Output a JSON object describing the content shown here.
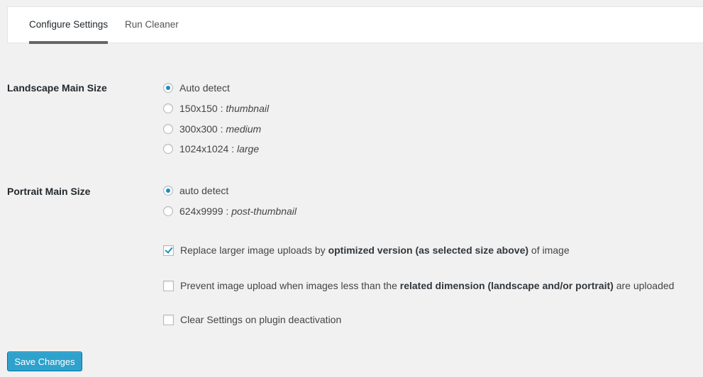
{
  "tabs": [
    {
      "label": "Configure Settings",
      "active": true
    },
    {
      "label": "Run Cleaner",
      "active": false
    }
  ],
  "landscape": {
    "label": "Landscape Main Size",
    "options": [
      {
        "size": "Auto detect",
        "name": "",
        "checked": true
      },
      {
        "size": "150x150 : ",
        "name": "thumbnail",
        "checked": false
      },
      {
        "size": "300x300 : ",
        "name": "medium",
        "checked": false
      },
      {
        "size": "1024x1024 : ",
        "name": "large",
        "checked": false
      }
    ]
  },
  "portrait": {
    "label": "Portrait Main Size",
    "options": [
      {
        "size": "auto detect",
        "name": "",
        "checked": true
      },
      {
        "size": "624x9999 : ",
        "name": "post-thumbnail",
        "checked": false
      }
    ]
  },
  "checkboxes": [
    {
      "pre": "Replace larger image uploads by ",
      "bold": "optimized version (as selected size above)",
      "post": " of image",
      "checked": true
    },
    {
      "pre": "Prevent image upload when images less than the ",
      "bold": "related dimension (landscape and/or portrait)",
      "post": " are uploaded",
      "checked": false
    },
    {
      "pre": "Clear Settings on plugin deactivation",
      "bold": "",
      "post": "",
      "checked": false
    }
  ],
  "save_label": "Save Changes"
}
